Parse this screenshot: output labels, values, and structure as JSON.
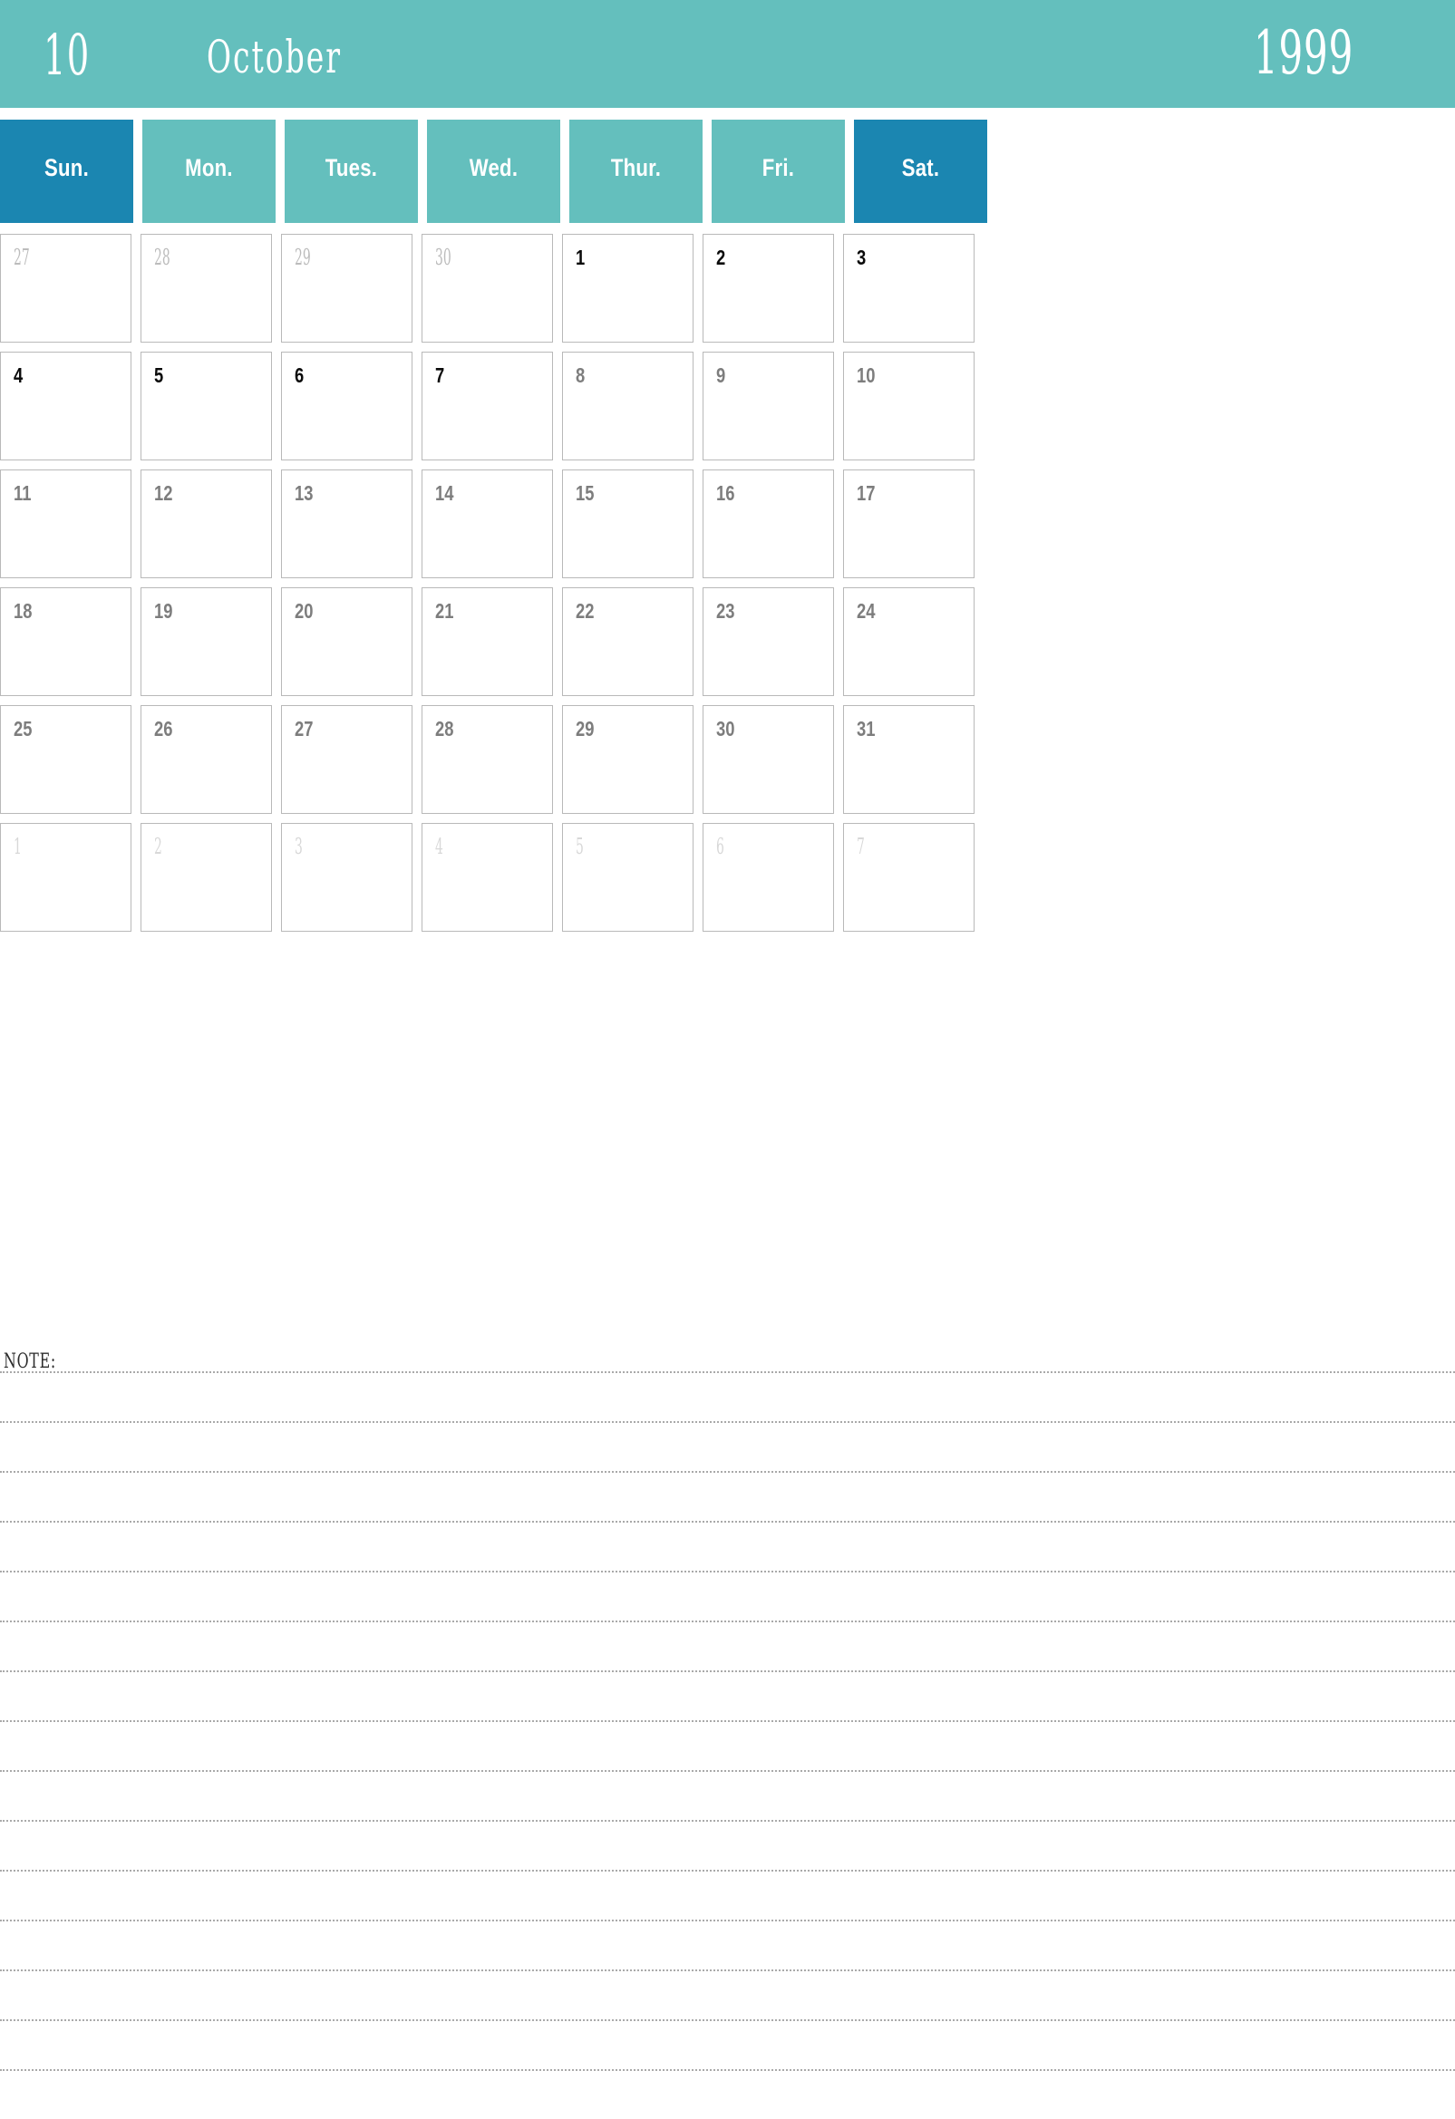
{
  "header": {
    "month_number": "10",
    "month_name": "October",
    "year": "1999",
    "background_color": "#64bfbd",
    "text_color": "#ffffff"
  },
  "weekdays": [
    {
      "label": "Sun.",
      "weekend": true,
      "color": "#1b86b1"
    },
    {
      "label": "Mon.",
      "weekend": false,
      "color": "#64bfbd"
    },
    {
      "label": "Tues.",
      "weekend": false,
      "color": "#64bfbd"
    },
    {
      "label": "Wed.",
      "weekend": false,
      "color": "#64bfbd"
    },
    {
      "label": "Thur.",
      "weekend": false,
      "color": "#64bfbd"
    },
    {
      "label": "Fri.",
      "weekend": false,
      "color": "#64bfbd"
    },
    {
      "label": "Sat.",
      "weekend": true,
      "color": "#1b86b1"
    }
  ],
  "weeks": [
    [
      {
        "day": "27",
        "month": "prev",
        "emphasis": "muted"
      },
      {
        "day": "28",
        "month": "prev",
        "emphasis": "muted"
      },
      {
        "day": "29",
        "month": "prev",
        "emphasis": "muted"
      },
      {
        "day": "30",
        "month": "prev",
        "emphasis": "muted"
      },
      {
        "day": "1",
        "month": "current",
        "emphasis": "strong"
      },
      {
        "day": "2",
        "month": "current",
        "emphasis": "strong"
      },
      {
        "day": "3",
        "month": "current",
        "emphasis": "strong"
      }
    ],
    [
      {
        "day": "4",
        "month": "current",
        "emphasis": "strong"
      },
      {
        "day": "5",
        "month": "current",
        "emphasis": "strong"
      },
      {
        "day": "6",
        "month": "current",
        "emphasis": "strong"
      },
      {
        "day": "7",
        "month": "current",
        "emphasis": "strong"
      },
      {
        "day": "8",
        "month": "current",
        "emphasis": "normal"
      },
      {
        "day": "9",
        "month": "current",
        "emphasis": "normal"
      },
      {
        "day": "10",
        "month": "current",
        "emphasis": "normal"
      }
    ],
    [
      {
        "day": "11",
        "month": "current",
        "emphasis": "normal"
      },
      {
        "day": "12",
        "month": "current",
        "emphasis": "normal"
      },
      {
        "day": "13",
        "month": "current",
        "emphasis": "normal"
      },
      {
        "day": "14",
        "month": "current",
        "emphasis": "normal"
      },
      {
        "day": "15",
        "month": "current",
        "emphasis": "normal"
      },
      {
        "day": "16",
        "month": "current",
        "emphasis": "normal"
      },
      {
        "day": "17",
        "month": "current",
        "emphasis": "normal"
      }
    ],
    [
      {
        "day": "18",
        "month": "current",
        "emphasis": "normal"
      },
      {
        "day": "19",
        "month": "current",
        "emphasis": "normal"
      },
      {
        "day": "20",
        "month": "current",
        "emphasis": "normal"
      },
      {
        "day": "21",
        "month": "current",
        "emphasis": "normal"
      },
      {
        "day": "22",
        "month": "current",
        "emphasis": "normal"
      },
      {
        "day": "23",
        "month": "current",
        "emphasis": "normal"
      },
      {
        "day": "24",
        "month": "current",
        "emphasis": "normal"
      }
    ],
    [
      {
        "day": "25",
        "month": "current",
        "emphasis": "normal"
      },
      {
        "day": "26",
        "month": "current",
        "emphasis": "normal"
      },
      {
        "day": "27",
        "month": "current",
        "emphasis": "normal"
      },
      {
        "day": "28",
        "month": "current",
        "emphasis": "normal"
      },
      {
        "day": "29",
        "month": "current",
        "emphasis": "normal"
      },
      {
        "day": "30",
        "month": "current",
        "emphasis": "normal"
      },
      {
        "day": "31",
        "month": "current",
        "emphasis": "normal"
      }
    ],
    [
      {
        "day": "1",
        "month": "next",
        "emphasis": "faint"
      },
      {
        "day": "2",
        "month": "next",
        "emphasis": "faint"
      },
      {
        "day": "3",
        "month": "next",
        "emphasis": "faint"
      },
      {
        "day": "4",
        "month": "next",
        "emphasis": "faint"
      },
      {
        "day": "5",
        "month": "next",
        "emphasis": "faint"
      },
      {
        "day": "6",
        "month": "next",
        "emphasis": "faint"
      },
      {
        "day": "7",
        "month": "next",
        "emphasis": "faint"
      }
    ]
  ],
  "note": {
    "label": "NOTE:",
    "line_count": 15
  },
  "colors": {
    "teal": "#64bfbd",
    "blue": "#1b86b1",
    "cell_border": "#b9b9b9",
    "date_normal": "#7d7d7d",
    "date_strong": "#0a0a0a",
    "date_muted": "#bcbcbc",
    "date_faint": "#d8d8d8",
    "note_rule": "#9b9b9b"
  }
}
